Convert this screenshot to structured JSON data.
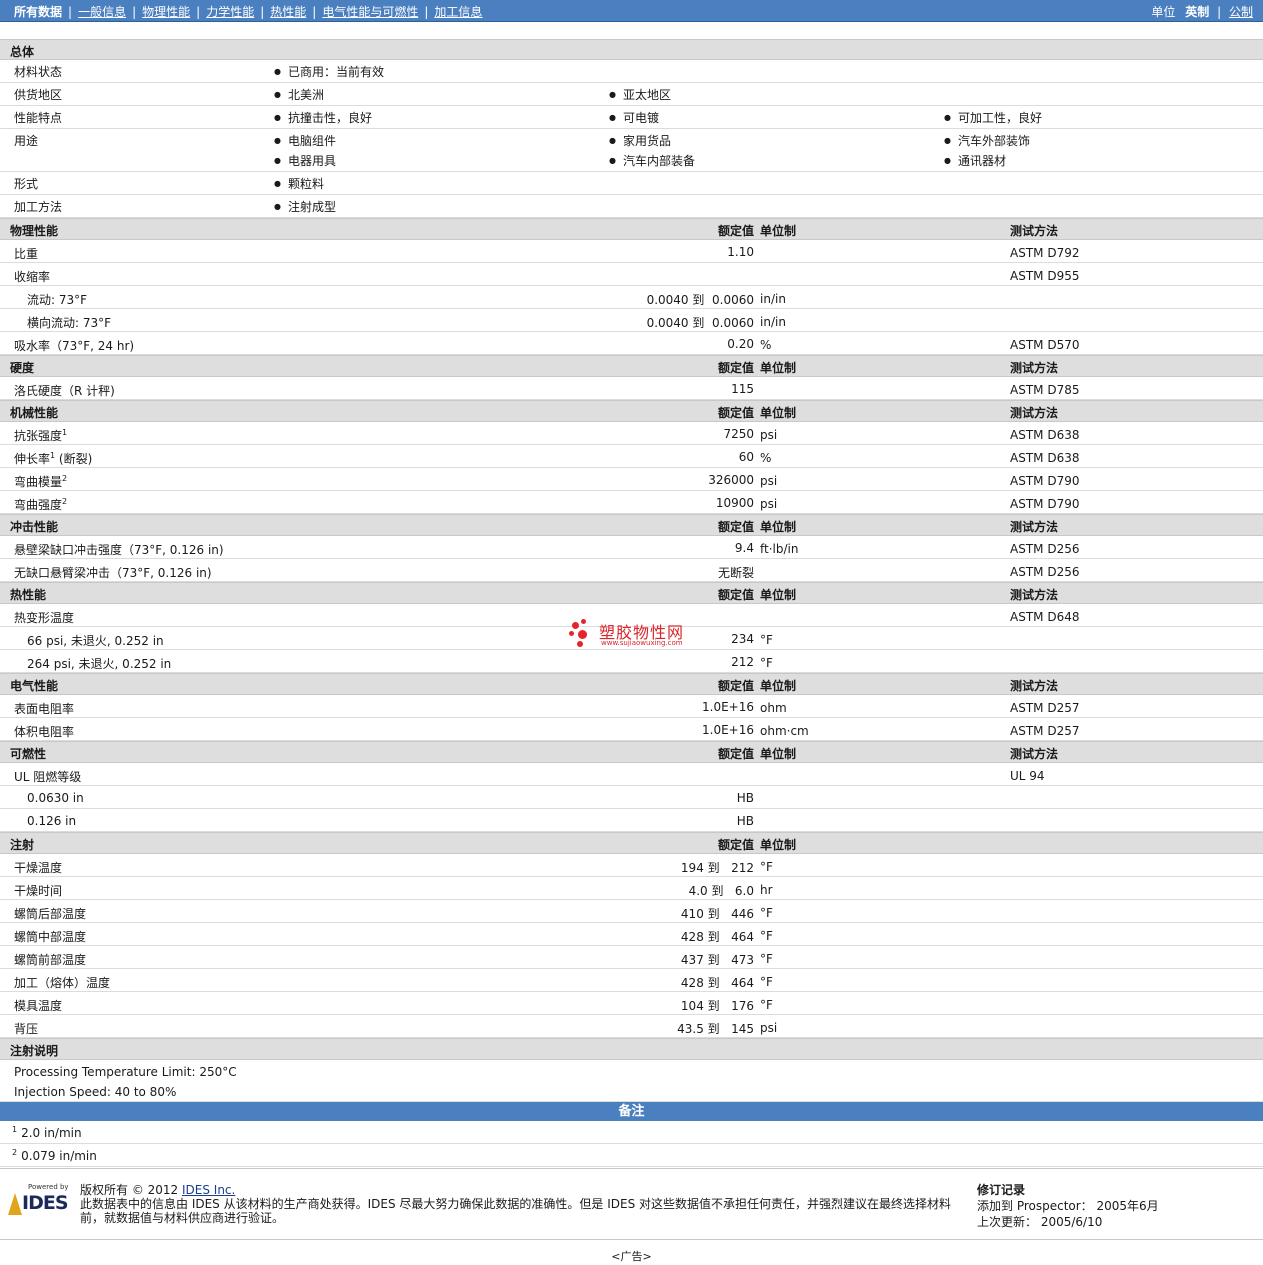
{
  "nav": {
    "current": "所有数据",
    "links": [
      "一般信息",
      "物理性能",
      "力学性能",
      "热性能",
      "电气性能与可燃性",
      "加工信息"
    ]
  },
  "units": {
    "label": "单位",
    "active": "英制",
    "other": "公制"
  },
  "general": {
    "title": "总体",
    "rows": [
      {
        "label": "材料状态",
        "items": [
          "已商用：当前有效"
        ]
      },
      {
        "label": "供货地区",
        "items": [
          "北美洲",
          "亚太地区"
        ]
      },
      {
        "label": "性能特点",
        "items": [
          "抗撞击性，良好",
          "可电镀",
          "可加工性，良好"
        ]
      },
      {
        "label": "用途",
        "items": [
          "电脑组件",
          "家用货品",
          "汽车外部装饰",
          "电器用具",
          "汽车内部装备",
          "通讯器材"
        ]
      },
      {
        "label": "形式",
        "items": [
          "颗粒料"
        ]
      },
      {
        "label": "加工方法",
        "items": [
          "注射成型"
        ]
      }
    ]
  },
  "columns": {
    "nominal": "额定值",
    "unit": "单位制",
    "method": "测试方法"
  },
  "sections": [
    {
      "title": "物理性能",
      "rows": [
        {
          "label": "比重",
          "value": "1.10",
          "unit": "",
          "method": "ASTM D792"
        },
        {
          "label": "收缩率",
          "value": "",
          "unit": "",
          "method": "ASTM D955"
        },
        {
          "label": "流动: 73°F",
          "indent": true,
          "value": "0.0040 到  0.0060",
          "unit": "in/in",
          "method": ""
        },
        {
          "label": "横向流动: 73°F",
          "indent": true,
          "value": "0.0040 到  0.0060",
          "unit": "in/in",
          "method": ""
        },
        {
          "label": "吸水率（73°F, 24 hr)",
          "value": "0.20",
          "unit": "%",
          "method": "ASTM D570"
        }
      ]
    },
    {
      "title": "硬度",
      "rows": [
        {
          "label": "洛氏硬度（R 计秤)",
          "value": "115",
          "unit": "",
          "method": "ASTM D785"
        }
      ]
    },
    {
      "title": "机械性能",
      "rows": [
        {
          "label": "抗张强度",
          "sup": "1",
          "value": "7250",
          "unit": "psi",
          "method": "ASTM D638"
        },
        {
          "label": "伸长率",
          "sup": "1",
          "suffix": " (断裂)",
          "value": "60",
          "unit": "%",
          "method": "ASTM D638"
        },
        {
          "label": "弯曲模量",
          "sup": "2",
          "value": "326000",
          "unit": "psi",
          "method": "ASTM D790"
        },
        {
          "label": "弯曲强度",
          "sup": "2",
          "value": "10900",
          "unit": "psi",
          "method": "ASTM D790"
        }
      ]
    },
    {
      "title": "冲击性能",
      "rows": [
        {
          "label": "悬壁梁缺口冲击强度（73°F, 0.126 in)",
          "value": "9.4",
          "unit": "ft·lb/in",
          "method": "ASTM D256"
        },
        {
          "label": "无缺口悬臂梁冲击（73°F, 0.126 in)",
          "value": "无断裂",
          "unit": "",
          "method": "ASTM D256"
        }
      ]
    },
    {
      "title": "热性能",
      "rows": [
        {
          "label": "热变形温度",
          "value": "",
          "unit": "",
          "method": "ASTM D648"
        },
        {
          "label": "66 psi, 未退火, 0.252 in",
          "indent": true,
          "value": "234",
          "unit": "°F",
          "method": ""
        },
        {
          "label": "264 psi, 未退火, 0.252 in",
          "indent": true,
          "value": "212",
          "unit": "°F",
          "method": ""
        }
      ]
    },
    {
      "title": "电气性能",
      "rows": [
        {
          "label": "表面电阻率",
          "value": "1.0E+16",
          "unit": "ohm",
          "method": "ASTM D257"
        },
        {
          "label": "体积电阻率",
          "value": "1.0E+16",
          "unit": "ohm·cm",
          "method": "ASTM D257"
        }
      ]
    },
    {
      "title": "可燃性",
      "rows": [
        {
          "label": "UL 阻燃等级",
          "value": "",
          "unit": "",
          "method": "UL 94"
        },
        {
          "label": "0.0630 in",
          "indent": true,
          "value": "HB",
          "unit": "",
          "method": ""
        },
        {
          "label": "0.126 in",
          "indent": true,
          "value": "HB",
          "unit": "",
          "method": ""
        }
      ]
    },
    {
      "title": "注射",
      "nomethod": true,
      "rows": [
        {
          "label": "干燥温度",
          "value": "194 到   212",
          "unit": "°F",
          "method": ""
        },
        {
          "label": "干燥时间",
          "value": "4.0 到   6.0",
          "unit": "hr",
          "method": ""
        },
        {
          "label": "螺筒后部温度",
          "value": "410 到   446",
          "unit": "°F",
          "method": ""
        },
        {
          "label": "螺筒中部温度",
          "value": "428 到   464",
          "unit": "°F",
          "method": ""
        },
        {
          "label": "螺筒前部温度",
          "value": "437 到   473",
          "unit": "°F",
          "method": ""
        },
        {
          "label": "加工（熔体）温度",
          "value": "428 到   464",
          "unit": "°F",
          "method": ""
        },
        {
          "label": "模具温度",
          "value": "104 到   176",
          "unit": "°F",
          "method": ""
        },
        {
          "label": "背压",
          "value": "43.5 到   145",
          "unit": "psi",
          "method": ""
        }
      ]
    }
  ],
  "injection_notes": {
    "title": "注射说明",
    "lines": [
      "Processing Temperature Limit: 250°C",
      "Injection Speed: 40 to 80%"
    ]
  },
  "notes": {
    "title": "备注",
    "items": [
      {
        "n": "1",
        "text": "2.0 in/min"
      },
      {
        "n": "2",
        "text": "0.079 in/min"
      }
    ]
  },
  "footer": {
    "logo_powered": "Powered by",
    "logo_text": "IDES",
    "copyright_prefix": "版权所有 © 2012 ",
    "copyright_link": "IDES Inc.",
    "disclaimer": "此数据表中的信息由 IDES 从该材料的生产商处获得。IDES 尽最大努力确保此数据的准确性。但是 IDES 对这些数据值不承担任何责任，并强烈建议在最终选择材料前，就数据值与材料供应商进行验证。",
    "rev_title": "修订记录",
    "rev_added": "添加到 Prospector： 2005年6月",
    "rev_updated": "上次更新： 2005/6/10",
    "ad": "<广告>"
  },
  "watermark": {
    "title": "塑胶物性网",
    "url": "www.sujiaowuxing.com"
  }
}
